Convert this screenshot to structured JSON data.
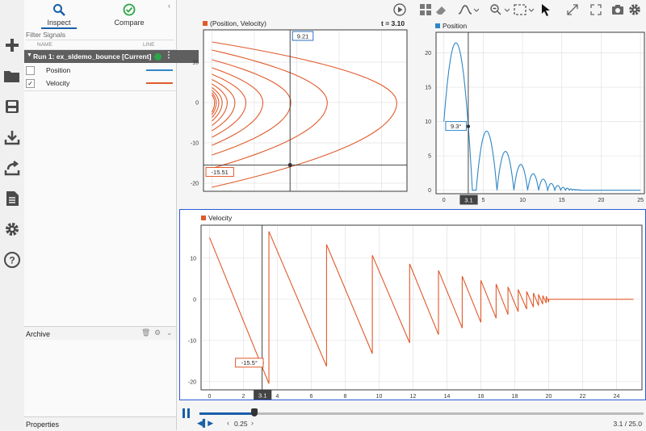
{
  "colors": {
    "position": "#2f86c6",
    "velocity": "#e05a2b",
    "accent": "#1a5ea8",
    "selected_border": "#2a5bd7",
    "run_bg": "#5f5f5f",
    "green": "#2aa646"
  },
  "leftbar": {
    "icons": [
      "new-icon",
      "open-folder-icon",
      "save-icon",
      "import-icon",
      "export-icon",
      "report-icon",
      "settings-icon",
      "help-icon"
    ]
  },
  "tabs": {
    "inspect": "Inspect",
    "compare": "Compare"
  },
  "filter": {
    "placeholder": "Filter Signals"
  },
  "columns": {
    "name": "NAME",
    "line": "LINE"
  },
  "run": {
    "label": "Run 1: ex_sldemo_bounce [Current]"
  },
  "signals": [
    {
      "name": "Position",
      "checked": false,
      "checkmark": ""
    },
    {
      "name": "Velocity",
      "checked": true,
      "checkmark": "✓"
    }
  ],
  "archive": {
    "label": "Archive"
  },
  "properties": {
    "label": "Properties"
  },
  "plot_xy": {
    "legend": "(Position, Velocity)",
    "time": "t = 3.10",
    "cursor_x_label": "9.21",
    "cursor_y_label": "-15.51"
  },
  "plot_position": {
    "legend": "Position",
    "value_label": "9.3°",
    "cursor_time": "3.1"
  },
  "plot_velocity": {
    "legend": "Velocity",
    "value_label": "-15.5°",
    "cursor_time": "3.1"
  },
  "playback": {
    "speed": "0.25",
    "time": "3.1 / 25.0",
    "progress": 0.124
  },
  "chart_data": [
    {
      "type": "line",
      "title": "(Position, Velocity)",
      "xlim": [
        -1,
        23
      ],
      "ylim": [
        -22,
        18
      ],
      "xticks": [
        0,
        5,
        10,
        15,
        20
      ],
      "yticks": [
        10,
        0,
        -10,
        -20
      ],
      "grid": true,
      "series": [
        {
          "name": "(Position, Velocity)",
          "type": "phase-spiral",
          "bounces": [
            {
              "apex_x": 21.8,
              "v_in": -21.0,
              "v_out": 15.0
            },
            {
              "apex_x": 13.6,
              "v_in": -16.3,
              "v_out": 13.0
            },
            {
              "apex_x": 9.3,
              "v_in": -13.0,
              "v_out": 10.6
            },
            {
              "apex_x": 6.0,
              "v_in": -10.6,
              "v_out": 8.6
            },
            {
              "apex_x": 4.0,
              "v_in": -8.6,
              "v_out": 7.0
            },
            {
              "apex_x": 2.7,
              "v_in": -7.0,
              "v_out": 5.7
            },
            {
              "apex_x": 1.8,
              "v_in": -5.7,
              "v_out": 4.6
            },
            {
              "apex_x": 1.2,
              "v_in": -4.6,
              "v_out": 3.7
            },
            {
              "apex_x": 0.8,
              "v_in": -3.7,
              "v_out": 3.0
            },
            {
              "apex_x": 0.5,
              "v_in": -3.0,
              "v_out": 2.4
            },
            {
              "apex_x": 0.3,
              "v_in": -2.4,
              "v_out": 1.9
            }
          ]
        }
      ],
      "cursor": {
        "x": 9.21,
        "y": -15.51
      }
    },
    {
      "type": "line",
      "title": "Position",
      "xlim": [
        -1,
        25.5
      ],
      "ylim": [
        -0.5,
        23
      ],
      "xticks": [
        0,
        5,
        10,
        15,
        20,
        25
      ],
      "yticks": [
        0,
        5,
        10,
        15,
        20
      ],
      "grid": true,
      "series": [
        {
          "name": "Position",
          "bounce_times": [
            0,
            4.1,
            6.75,
            8.9,
            10.65,
            12.05,
            13.2,
            14.1,
            14.85,
            15.45,
            15.95,
            16.35,
            16.7,
            17.0,
            17.25,
            17.45,
            17.6
          ],
          "initial": 10,
          "initial_velocity": 15,
          "ends_flat_at": 20,
          "xmax": 25
        }
      ],
      "cursor": {
        "x": 3.1,
        "y": 9.3
      }
    },
    {
      "type": "line",
      "title": "Velocity",
      "xlim": [
        -0.5,
        25.5
      ],
      "ylim": [
        -22,
        18
      ],
      "xticks": [
        0,
        2,
        4,
        6,
        8,
        10,
        12,
        14,
        16,
        18,
        20,
        22,
        24
      ],
      "yticks": [
        10,
        0,
        -10,
        -20
      ],
      "grid": true,
      "series": [
        {
          "name": "Velocity",
          "points": [
            [
              0,
              15
            ],
            [
              3.5,
              -20.5
            ],
            [
              3.5,
              16.5
            ],
            [
              6.9,
              -16.3
            ],
            [
              6.9,
              13.3
            ],
            [
              9.6,
              -13.2
            ],
            [
              9.6,
              10.7
            ],
            [
              11.8,
              -10.6
            ],
            [
              11.8,
              8.6
            ],
            [
              13.5,
              -8.6
            ],
            [
              13.5,
              7.0
            ],
            [
              14.9,
              -7.0
            ],
            [
              14.9,
              5.6
            ],
            [
              16.0,
              -5.6
            ],
            [
              16.0,
              4.6
            ],
            [
              16.9,
              -4.6
            ],
            [
              16.9,
              3.7
            ],
            [
              17.6,
              -3.7
            ],
            [
              17.6,
              3.0
            ],
            [
              18.2,
              -3.0
            ],
            [
              18.2,
              2.4
            ],
            [
              18.7,
              -2.4
            ],
            [
              18.7,
              1.9
            ],
            [
              19.1,
              -1.9
            ],
            [
              19.1,
              1.5
            ],
            [
              19.4,
              -1.5
            ],
            [
              19.4,
              1.2
            ],
            [
              19.65,
              -1.2
            ],
            [
              19.65,
              0.9
            ],
            [
              19.85,
              -0.9
            ],
            [
              19.85,
              0.7
            ],
            [
              20.0,
              -0.7
            ],
            [
              20.0,
              0
            ],
            [
              25,
              0
            ]
          ]
        }
      ],
      "cursor": {
        "x": 3.1,
        "y": -15.5
      }
    }
  ]
}
